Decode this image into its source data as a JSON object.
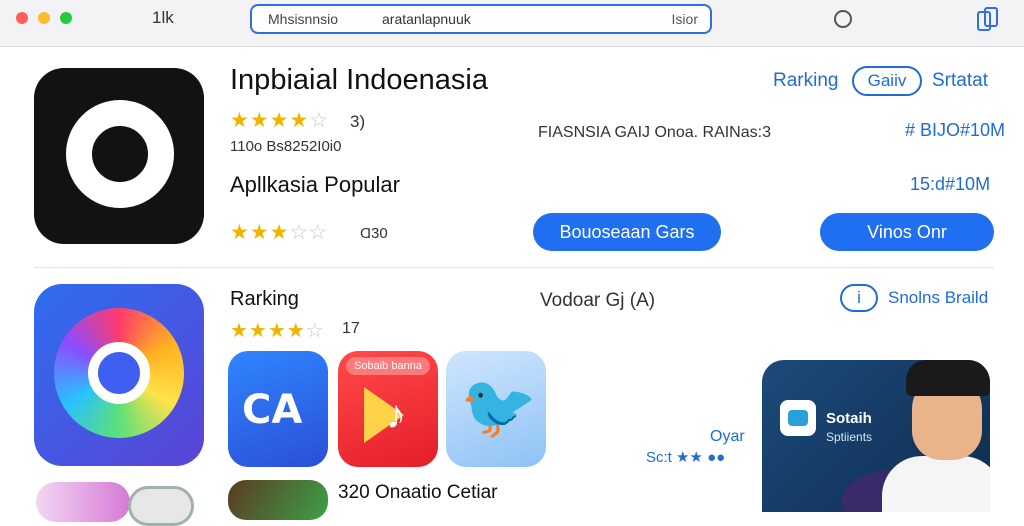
{
  "toolbar": {
    "tab_count": "1lk",
    "address_left": "Mhsisnnsio",
    "address_text": "aratanlapnuuk",
    "address_right": "Isior"
  },
  "app1": {
    "title": "Inpbiaial Indoenasia",
    "rating_stars": "★★★★",
    "rating_half": "☆",
    "rating_count": "3)",
    "meta": "110o Bs8252I0i0",
    "subtitle": "Apllkasia Popular",
    "rating2_stars": "★★★",
    "rating2_half": "☆☆",
    "rating2_count": "Ɑ30",
    "center_text": "FIASNSIA GAIJ Onoa. RAINas:3",
    "links": {
      "ranking": "Rarking",
      "chip": "Gaiiv",
      "start": "Srtatat"
    },
    "value1": "# BIJO#10M",
    "value2": "15:d#10M",
    "buttons": {
      "primary": "Bouoseaan Gars",
      "secondary": "Vinos Onr"
    }
  },
  "app2": {
    "ranking": "Rarking",
    "rating_stars": "★★★★",
    "rating_half": "☆",
    "rating_count": "17",
    "center_text": "Vodoar Gj (A)",
    "info_icon": "i",
    "info_label": "Snolns Braild",
    "mini1_text": "CA",
    "mini2_banner": "Sobaib banna",
    "mini2_note": "♪",
    "mini3_symbol": "🐦",
    "bottom_title": "320 Onaatio Cetiar",
    "oyar": "Oyar",
    "small_rating": "Sc:t ★★ ●●"
  },
  "feature": {
    "title": "Sotaih",
    "subtitle": "Sptiients"
  },
  "colors": {
    "accent": "#1f6cd6",
    "button": "#1f6ff0",
    "star": "#f0b400"
  }
}
